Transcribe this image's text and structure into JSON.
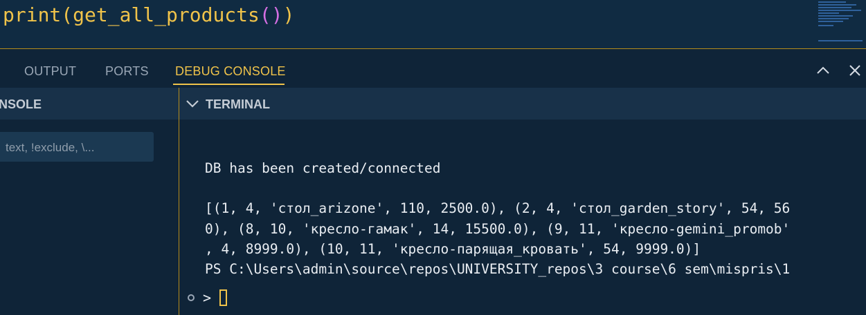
{
  "editor": {
    "code": {
      "fn": "print",
      "open1": "(",
      "call": "get_all_products",
      "open2": "(",
      "close2": ")",
      "close1": ")"
    }
  },
  "panel": {
    "tabs": [
      {
        "label": "OUTPUT"
      },
      {
        "label": "PORTS"
      },
      {
        "label": "DEBUG CONSOLE",
        "active": true
      }
    ],
    "actions": {
      "maximize_icon": "chevron-up-icon",
      "close_icon": "close-icon"
    }
  },
  "console": {
    "title": "NSOLE",
    "filter_placeholder": "text, !exclude, \\..."
  },
  "terminal": {
    "title": "TERMINAL",
    "lines": [
      "DB has been created/connected",
      "",
      "[(1, 4, 'стол_arizone', 110, 2500.0), (2, 4, 'стол_garden_story', 54, 56",
      "0), (8, 10, 'кресло-гамак', 14, 15500.0), (9, 11, 'кресло-gemini_promob'",
      ", 4, 8999.0), (10, 11, 'кресло-парящая_кровать', 54, 9999.0)]",
      "PS C:\\Users\\admin\\source\\repos\\UNIVERSITY_repos\\3 course\\6 sem\\mispris\\1"
    ],
    "prompt_symbol": ">"
  },
  "colors": {
    "accent": "#f0c34a",
    "background": "#0f2438",
    "header": "#183149",
    "border": "#b78d1b"
  }
}
